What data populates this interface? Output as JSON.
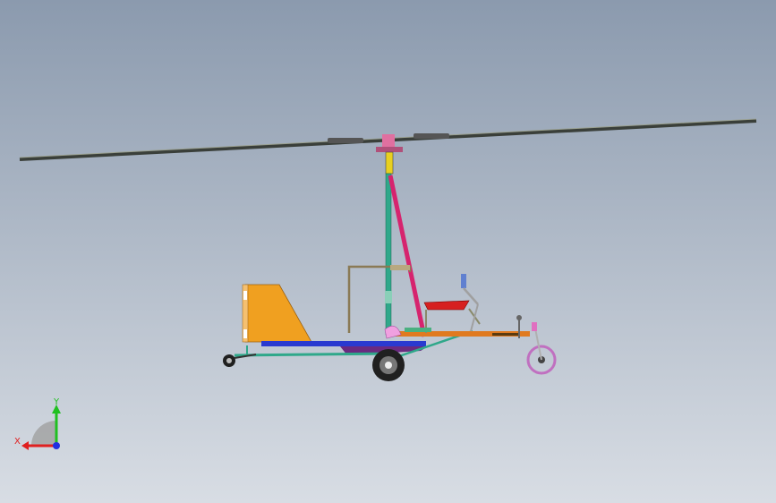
{
  "viewport": {
    "background_top": "#8b9aae",
    "background_bottom": "#d8dde4"
  },
  "model": {
    "name": "autogyro-assembly",
    "colors": {
      "rotor": "#3a3f3a",
      "mast": "#2fa88a",
      "strut": "#d6246e",
      "tail": "#f0a020",
      "keel": "#2a3ad0",
      "frame": "#2fa88a",
      "orange_frame": "#e07a20",
      "seat": "#d62020",
      "seat_back": "#8a8a6a",
      "wheel": "#202020",
      "nose_wheel": "#c070c0",
      "yoke": "#6080d0",
      "hub": "#e070a0",
      "box": "#8a7a55",
      "purple": "#6a2a80"
    }
  },
  "triad": {
    "x_label": "X",
    "y_label": "Y",
    "x_color": "#e02020",
    "y_color": "#20c020",
    "z_color": "#2030e0"
  }
}
